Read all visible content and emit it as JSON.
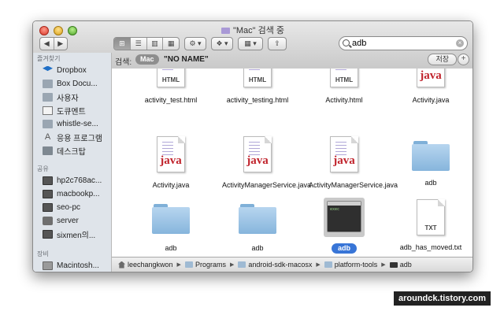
{
  "window": {
    "title": "\"Mac\" 검색 중"
  },
  "toolbar": {
    "search_value": "adb",
    "clear_symbol": "×",
    "back_symbol": "◀",
    "forward_symbol": "▶",
    "view_symbols": [
      "⊞",
      "☰",
      "▥",
      "▦"
    ],
    "action_symbol": "⚙ ▾",
    "dropbox_symbol": "❖ ▾",
    "arrange_symbol": "▦ ▾",
    "share_symbol": "⇪"
  },
  "scope": {
    "label": "검색:",
    "mac": "Mac",
    "name": "\"NO NAME\"",
    "save_label": "저장",
    "add_symbol": "+"
  },
  "sidebar": {
    "favorites_header": "즐겨찾기",
    "favorites": [
      "Dropbox",
      "Box Docu...",
      "사용자",
      "도큐멘트",
      "whistle-se...",
      "응용 프로그램",
      "데스크탑"
    ],
    "shared_header": "공유",
    "shared": [
      "hp2c768ac...",
      "macbookp...",
      "seo-pc",
      "server",
      "sixmen의..."
    ],
    "devices_header": "장비",
    "devices": [
      "Macintosh..."
    ]
  },
  "files": [
    {
      "name": "activity_test.html",
      "kind": "html",
      "tag": "HTML"
    },
    {
      "name": "activity_testing.html",
      "kind": "html",
      "tag": "HTML"
    },
    {
      "name": "Activity.html",
      "kind": "html",
      "tag": "HTML"
    },
    {
      "name": "Activity.java",
      "kind": "java",
      "tag": "java"
    },
    {
      "name": "Activity.java",
      "kind": "java",
      "tag": "java"
    },
    {
      "name": "ActivityManagerService.java",
      "kind": "java",
      "tag": "java"
    },
    {
      "name": "ActivityManagerService.java",
      "kind": "java",
      "tag": "java"
    },
    {
      "name": "adb",
      "kind": "folder"
    },
    {
      "name": "adb",
      "kind": "folder"
    },
    {
      "name": "adb",
      "kind": "folder"
    },
    {
      "name": "adb",
      "kind": "exec",
      "selected": true
    },
    {
      "name": "adb_has_moved.txt",
      "kind": "txt",
      "tag": "TXT"
    }
  ],
  "pathbar": [
    "leechangkwon",
    "Programs",
    "android-sdk-macosx",
    "platform-tools",
    "adb"
  ],
  "watermark": "aroundck.tistory.com"
}
